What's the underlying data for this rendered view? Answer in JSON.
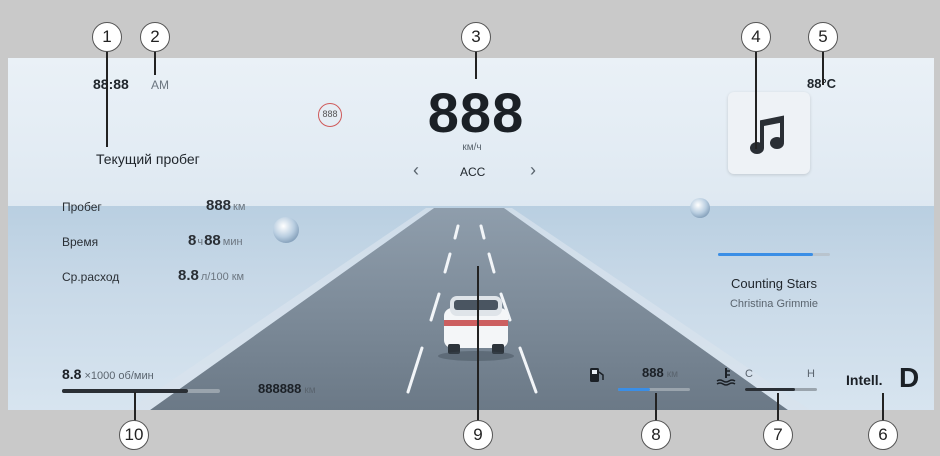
{
  "callouts": [
    "1",
    "2",
    "3",
    "4",
    "5",
    "6",
    "7",
    "8",
    "9",
    "10"
  ],
  "clock": {
    "time": "88:88",
    "ampm": "AM"
  },
  "outside_temp": "88°C",
  "speed": {
    "value": "888",
    "unit": "км/ч",
    "speed_limit": "888"
  },
  "acc": {
    "label": "ACC",
    "prev": "‹",
    "next": "›"
  },
  "trip": {
    "title": "Текущий пробег",
    "rows": [
      {
        "label": "Пробег",
        "value": "888",
        "unit": "км"
      },
      {
        "label": "Время",
        "value": "8",
        "unit": "ч",
        "value2": "88",
        "unit2": "мин"
      },
      {
        "label": "Ср.расход",
        "value": "8.8",
        "unit": "л/100 км"
      }
    ]
  },
  "media": {
    "icon": "music-note-icon",
    "title": "Counting Stars",
    "artist": "Christina Grimmie",
    "progress": 0.85
  },
  "rpm": {
    "value": "8.8",
    "unit": "×1000 об/мин",
    "level": 0.8
  },
  "odometer": {
    "value": "888888",
    "unit": "км"
  },
  "fuel": {
    "icon": "fuel-pump-icon",
    "range": "888",
    "unit": "км",
    "level": 0.45
  },
  "coolant": {
    "icon": "coolant-temp-icon",
    "cold": "C",
    "hot": "H",
    "level": 0.7
  },
  "gear": {
    "mode": "Intell.",
    "gear": "D"
  },
  "colors": {
    "accent": "#3a8ee6",
    "text": "#2a2f35",
    "bar_track": "#9aa4ad"
  }
}
